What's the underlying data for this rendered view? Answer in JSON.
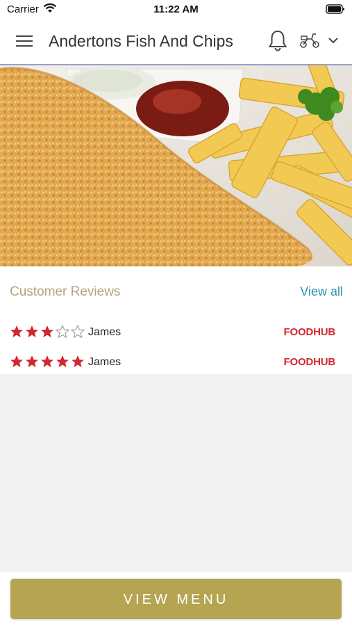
{
  "status_bar": {
    "carrier": "Carrier",
    "time": "11:22 AM"
  },
  "header": {
    "title": "Andertons Fish And Chips"
  },
  "reviews": {
    "title": "Customer Reviews",
    "view_all": "View all",
    "items": [
      {
        "name": "James",
        "rating": 3,
        "max": 5,
        "source": "FOODHUB"
      },
      {
        "name": "James",
        "rating": 5,
        "max": 5,
        "source": "FOODHUB"
      }
    ]
  },
  "cta": {
    "label": "VIEW MENU"
  },
  "colors": {
    "accent": "#b5a451",
    "star": "#d3262e",
    "link": "#2c93b3",
    "section_title": "#b3a27c",
    "brand": "#d3262e"
  },
  "icons": [
    "hamburger-menu-icon",
    "bell-icon",
    "scooter-icon",
    "chevron-down-icon",
    "star-icon",
    "wifi-icon",
    "battery-icon"
  ]
}
